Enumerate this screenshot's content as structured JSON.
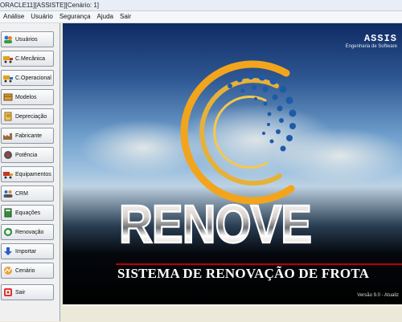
{
  "window": {
    "title": "ORACLE11][ASSISTE][Cenário: 1]"
  },
  "menu": [
    {
      "label": "Análise"
    },
    {
      "label": "Usuário"
    },
    {
      "label": "Segurança"
    },
    {
      "label": "Ajuda"
    },
    {
      "label": "Sair"
    }
  ],
  "sidebar": {
    "items": [
      {
        "label": "Usuários",
        "icon": "users-icon"
      },
      {
        "label": "C.Mecânica",
        "icon": "truck-icon"
      },
      {
        "label": "C.Operacional",
        "icon": "truck-icon"
      },
      {
        "label": "Modelos",
        "icon": "box-icon"
      },
      {
        "label": "Depreciação",
        "icon": "notebook-icon"
      },
      {
        "label": "Fabricante",
        "icon": "factory-icon"
      },
      {
        "label": "Potência",
        "icon": "disc-icon"
      },
      {
        "label": "Equipamentos",
        "icon": "truck-icon"
      },
      {
        "label": "CRM",
        "icon": "people-icon"
      },
      {
        "label": "Equações",
        "icon": "calculator-icon"
      },
      {
        "label": "Renovação",
        "icon": "cycle-icon"
      },
      {
        "label": "Importar",
        "icon": "import-arrow-icon"
      },
      {
        "label": "Cenário",
        "icon": "scenario-icon"
      },
      {
        "label": "Sair",
        "icon": "exit-icon"
      }
    ]
  },
  "splash": {
    "brand_name": "ASSIS",
    "brand_tagline": "Engenharia de Software",
    "logo_text": "RENOVE",
    "subtitle": "SISTEMA DE RENOVAÇÃO DE FROTA",
    "version": "Versão 9.0 - Atualiz"
  },
  "colors": {
    "accent_red": "#b00000",
    "logo_orange": "#f2a51c",
    "logo_blue": "#1e5aa8"
  }
}
